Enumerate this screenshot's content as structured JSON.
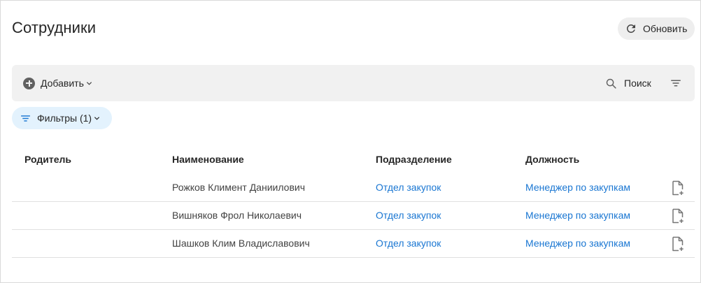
{
  "header": {
    "title": "Сотрудники",
    "refresh_label": "Обновить",
    "refresh_icon": "refresh-icon"
  },
  "toolbar": {
    "add_label": "Добавить",
    "add_icon": "plus-circle-icon",
    "search_label": "Поиск",
    "search_icon": "search-icon",
    "sort_icon": "sort-lines-icon"
  },
  "filters": {
    "label": "Фильтры (1)",
    "icon": "filter-icon",
    "chip_color": "#e3f2fd"
  },
  "table": {
    "columns": [
      "Родитель",
      "Наименование",
      "Подразделение",
      "Должность"
    ],
    "rows": [
      {
        "parent": "",
        "name": "Рожков Климент Даниилович",
        "department": "Отдел закупок",
        "position": "Менеджер по закупкам"
      },
      {
        "parent": "",
        "name": "Вишняков Фрол Николаевич",
        "department": "Отдел закупок",
        "position": "Менеджер по закупкам"
      },
      {
        "parent": "",
        "name": "Шашков Клим Владиславович",
        "department": "Отдел закупок",
        "position": "Менеджер по закупкам"
      }
    ],
    "row_action_icon": "document-add-icon"
  },
  "colors": {
    "link": "#1976d2",
    "toolbar_bg": "#f1f1f1",
    "refresh_bg": "#eeeeee"
  }
}
